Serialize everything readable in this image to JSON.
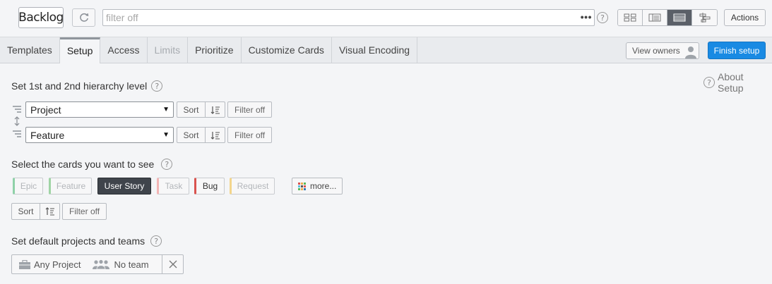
{
  "header": {
    "title": "Backlog",
    "filter_placeholder": "filter off",
    "filter_more": "•••",
    "help": "?",
    "actions_label": "Actions",
    "views": [
      {
        "icon": "board-view-icon",
        "active": false
      },
      {
        "icon": "list-view-icon",
        "active": false
      },
      {
        "icon": "detailed-list-view-icon",
        "active": true
      },
      {
        "icon": "timeline-view-icon",
        "active": false
      }
    ]
  },
  "tabs": [
    {
      "label": "Templates",
      "state": "normal"
    },
    {
      "label": "Setup",
      "state": "active"
    },
    {
      "label": "Access",
      "state": "normal"
    },
    {
      "label": "Limits",
      "state": "disabled"
    },
    {
      "label": "Prioritize",
      "state": "normal"
    },
    {
      "label": "Customize Cards",
      "state": "normal"
    },
    {
      "label": "Visual Encoding",
      "state": "normal"
    }
  ],
  "tabbar_actions": {
    "view_owners": "View owners",
    "finish_setup": "Finish setup"
  },
  "about_setup": "About Setup",
  "hierarchy": {
    "label": "Set 1st and 2nd hierarchy level",
    "levels": [
      {
        "value": "Project",
        "sort_label": "Sort",
        "filter_label": "Filter off"
      },
      {
        "value": "Feature",
        "sort_label": "Sort",
        "filter_label": "Filter off"
      }
    ]
  },
  "cards": {
    "label": "Select the cards you want to see",
    "types": [
      {
        "label": "Epic",
        "state": "off",
        "accent": "#8fd1a8"
      },
      {
        "label": "Feature",
        "state": "off",
        "accent": "#9fd4a4"
      },
      {
        "label": "User Story",
        "state": "selected",
        "accent": "#3f444b"
      },
      {
        "label": "Task",
        "state": "off",
        "accent": "#f3b5b5"
      },
      {
        "label": "Bug",
        "state": "on",
        "accent": "#d9534f"
      },
      {
        "label": "Request",
        "state": "off",
        "accent": "#f3d58c"
      }
    ],
    "more_label": "more...",
    "sort_label": "Sort",
    "filter_label": "Filter off"
  },
  "defaults": {
    "label": "Set default projects and teams",
    "project": "Any Project",
    "team": "No team"
  }
}
